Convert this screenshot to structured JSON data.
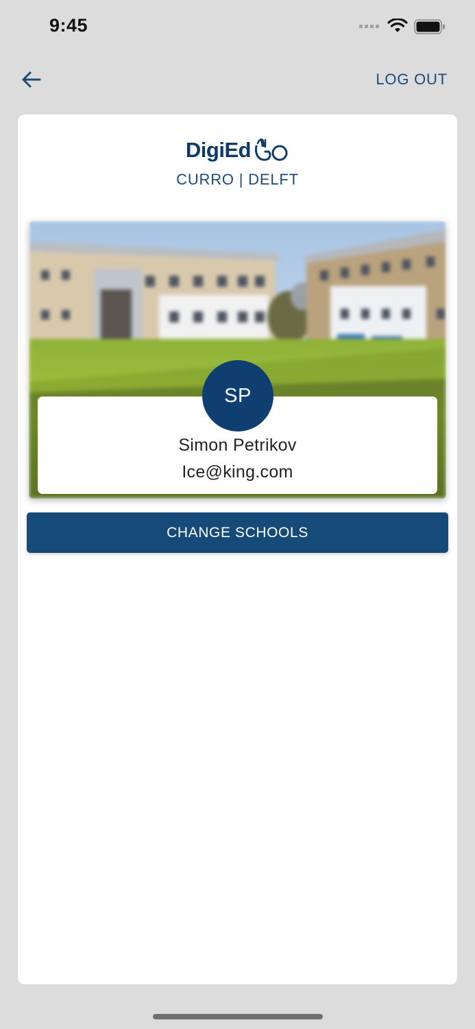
{
  "status_bar": {
    "time": "9:45",
    "icons": [
      "cellular-signal-icon",
      "wifi-icon",
      "battery-icon"
    ]
  },
  "nav": {
    "back_icon": "back-arrow-icon",
    "logout_label": "LOG OUT"
  },
  "logo": {
    "wordmark": "DigiEd",
    "school": "CURRO | DELFT"
  },
  "profile": {
    "initials": "SP",
    "name": "Simon Petrikov",
    "email": "Ice@king.com"
  },
  "actions": {
    "change_schools_label": "CHANGE SCHOOLS"
  },
  "colors": {
    "brand_navy": "#164b79",
    "avatar": "#0f3f70",
    "background": "#dcdcdc"
  }
}
